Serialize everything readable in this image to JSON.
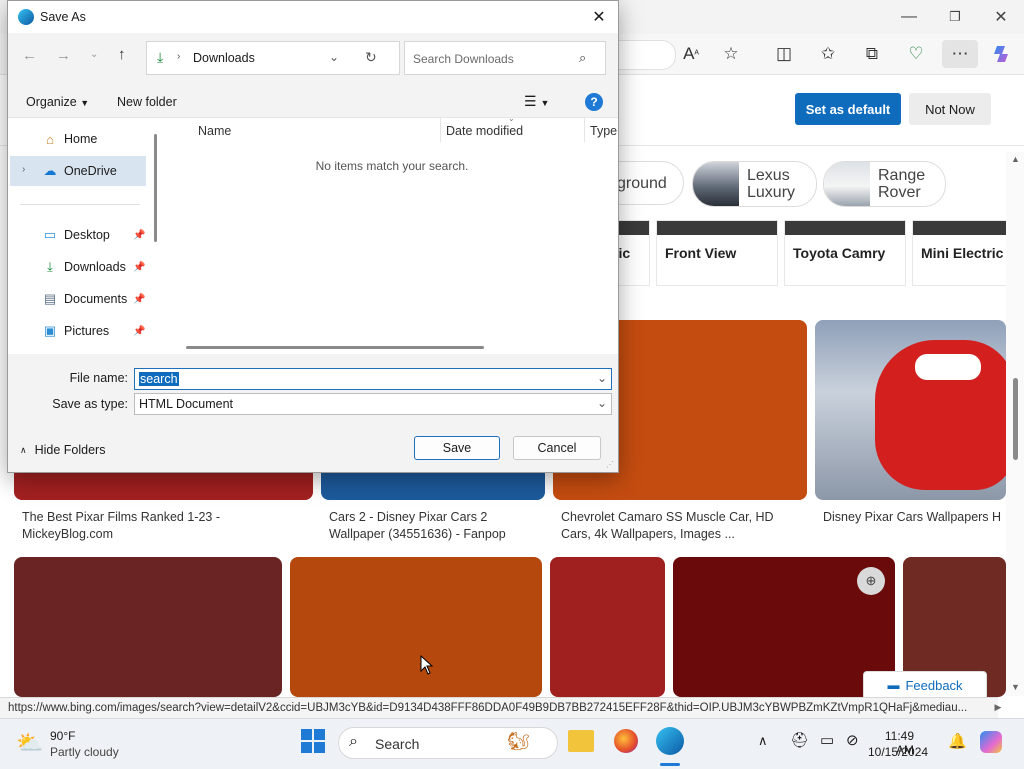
{
  "browser": {
    "title_controls": {
      "minimize": "—",
      "restore": "❐",
      "close": "✕"
    },
    "toolbar_icons": [
      "read-aloud-icon",
      "favorite-star-icon",
      "split-screen-icon",
      "favorites-icon",
      "collections-icon",
      "browser-essentials-icon",
      "more-options-icon",
      "copilot-icon"
    ],
    "set_default_label": "Set as default",
    "not_now_label": "Not Now",
    "pills": [
      {
        "label": "ground"
      },
      {
        "label": "Lexus\nLuxury"
      },
      {
        "label": "Range\nRover"
      }
    ],
    "tiles": [
      "ric",
      "Front View",
      "Toyota Camry",
      "Mini Electric"
    ],
    "results": [
      {
        "caption": "The Best Pixar Films Ranked 1-23 - MickeyBlog.com",
        "color": "#a32020"
      },
      {
        "caption": "Cars 2 - Disney Pixar Cars 2 Wallpaper (34551636) - Fanpop",
        "color": "#1c5a9c"
      },
      {
        "caption": "Chevrolet Camaro SS Muscle Car, HD Cars, 4k Wallpapers, Images ...",
        "color": "#c44c10"
      },
      {
        "caption": "Disney Pixar Cars Wallpapers H",
        "color": "#b7c3d6"
      }
    ],
    "row2_colors": [
      "#6b2424",
      "#b5480c",
      "#a01f1f",
      "#6a0a0a",
      "#6f2a24"
    ],
    "feedback_label": "Feedback",
    "status_url": "https://www.bing.com/images/search?view=detailV2&ccid=UBJM3cYB&id=D9134D438FFF86DDA0F49B9DB7BB272415EFF28F&thid=OIP.UBJM3cYBWPBZmKZtVmpR1QHaFj&mediau..."
  },
  "dialog": {
    "title": "Save As",
    "close_label": "✕",
    "location": "Downloads",
    "search_placeholder": "Search Downloads",
    "organize_label": "Organize",
    "new_folder_label": "New folder",
    "tree": [
      {
        "label": "Home",
        "icon": "home-icon"
      },
      {
        "label": "OneDrive",
        "icon": "onedrive-icon",
        "selected": true
      },
      {
        "label": "Desktop",
        "icon": "desktop-icon",
        "pinned": true
      },
      {
        "label": "Downloads",
        "icon": "download-icon",
        "pinned": true
      },
      {
        "label": "Documents",
        "icon": "documents-icon",
        "pinned": true
      },
      {
        "label": "Pictures",
        "icon": "pictures-icon",
        "pinned": true
      }
    ],
    "columns": {
      "name": "Name",
      "date": "Date modified",
      "type": "Type"
    },
    "empty_message": "No items match your search.",
    "file_name_label": "File name:",
    "file_name_value": "search",
    "save_type_label": "Save as type:",
    "save_type_value": "HTML Document",
    "hide_folders_label": "Hide Folders",
    "save_label": "Save",
    "cancel_label": "Cancel"
  },
  "taskbar": {
    "weather_temp": "90°F",
    "weather_desc": "Partly cloudy",
    "search_label": "Search",
    "time": "11:49 AM",
    "date": "10/15/2024"
  }
}
